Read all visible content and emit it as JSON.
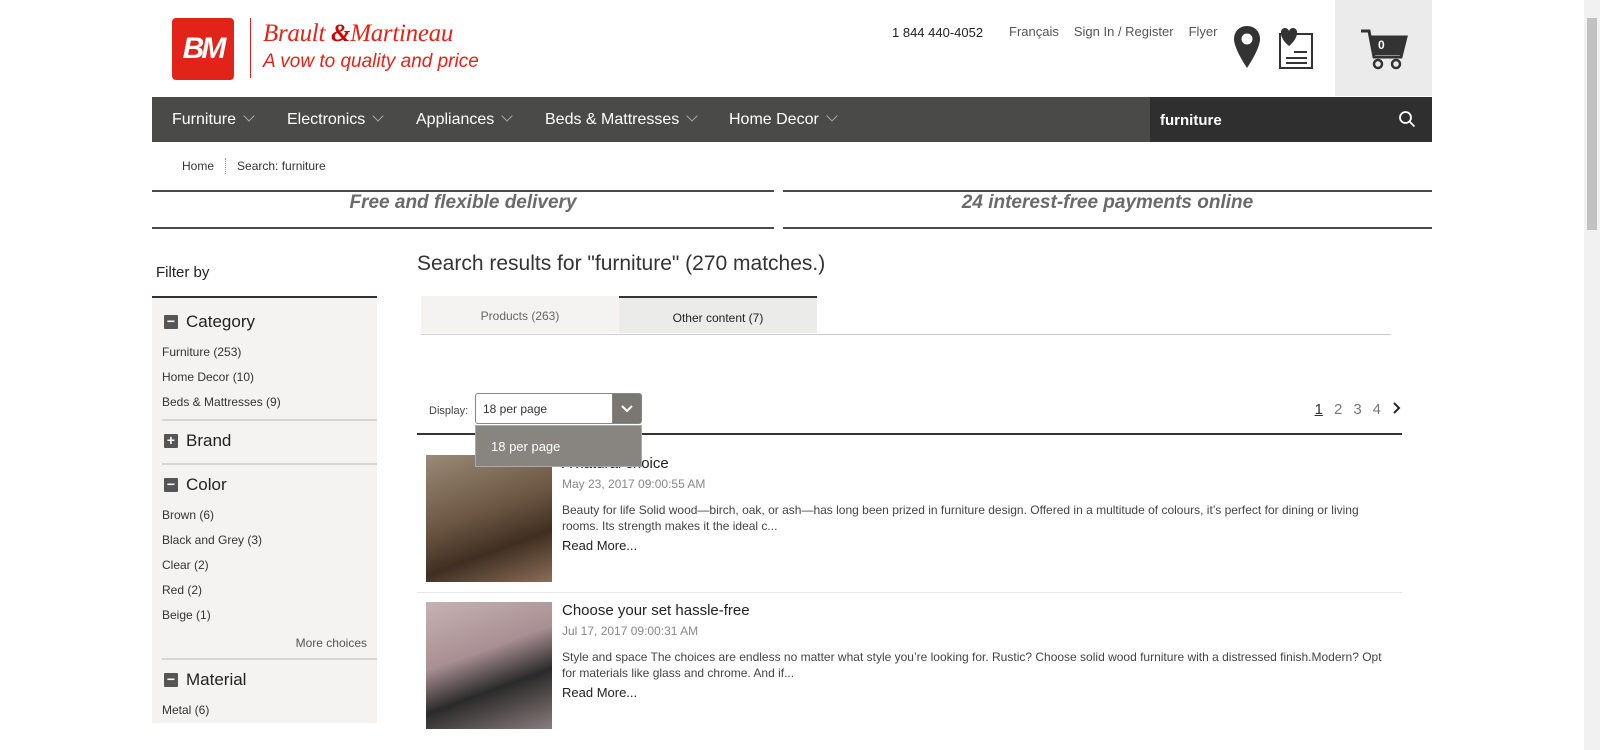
{
  "brand": {
    "logo_mark": "BM",
    "name_part1": "Brault",
    "name_amp": "&",
    "name_part2": "Martineau",
    "tagline": "A vow to quality and price",
    "color": "#e2231a"
  },
  "header": {
    "phone": "1 844 440-4052",
    "links": [
      "Français",
      "Sign In / Register",
      "Flyer"
    ],
    "cart_count": "0"
  },
  "nav": {
    "items": [
      "Furniture",
      "Electronics",
      "Appliances",
      "Beds & Mattresses",
      "Home Decor"
    ]
  },
  "search": {
    "value": "furniture"
  },
  "breadcrumb": [
    "Home",
    "Search: furniture"
  ],
  "banners": [
    "Free and flexible delivery",
    "24 interest-free payments online"
  ],
  "sidebar": {
    "title": "Filter by",
    "category": {
      "label": "Category",
      "items": [
        "Furniture (253)",
        "Home Decor (10)",
        "Beds & Mattresses (9)"
      ]
    },
    "brand": {
      "label": "Brand"
    },
    "color": {
      "label": "Color",
      "items": [
        "Brown (6)",
        "Black and Grey (3)",
        "Clear (2)",
        "Red (2)",
        "Beige (1)"
      ],
      "more": "More choices"
    },
    "material": {
      "label": "Material",
      "items": [
        "Metal (6)"
      ]
    }
  },
  "results": {
    "title": "Search results for \"furniture\" (270 matches.)",
    "tabs": [
      "Products (263)",
      "Other content (7)"
    ],
    "display_label": "Display:",
    "per_page": "18 per page",
    "dropdown_option": "18 per page",
    "pages": [
      "1",
      "2",
      "3",
      "4"
    ],
    "articles": [
      {
        "title": "A natural choice",
        "date": "May 23, 2017 09:00:55 AM",
        "text": "Beauty for life Solid wood—birch, oak, or ash—has long been prized in furniture design. Offered in a multitude of colours, it’s perfect for dining or living rooms. Its strength makes it the ideal c...",
        "more": "Read More..."
      },
      {
        "title": "Choose your set hassle-free",
        "date": "Jul 17, 2017 09:00:31 AM",
        "text": "Style and space The choices are endless no matter what style you’re looking for. Rustic? Choose solid wood furniture with a distressed finish.Modern? Opt for materials like glass and chrome. And if...",
        "more": "Read More..."
      }
    ]
  }
}
